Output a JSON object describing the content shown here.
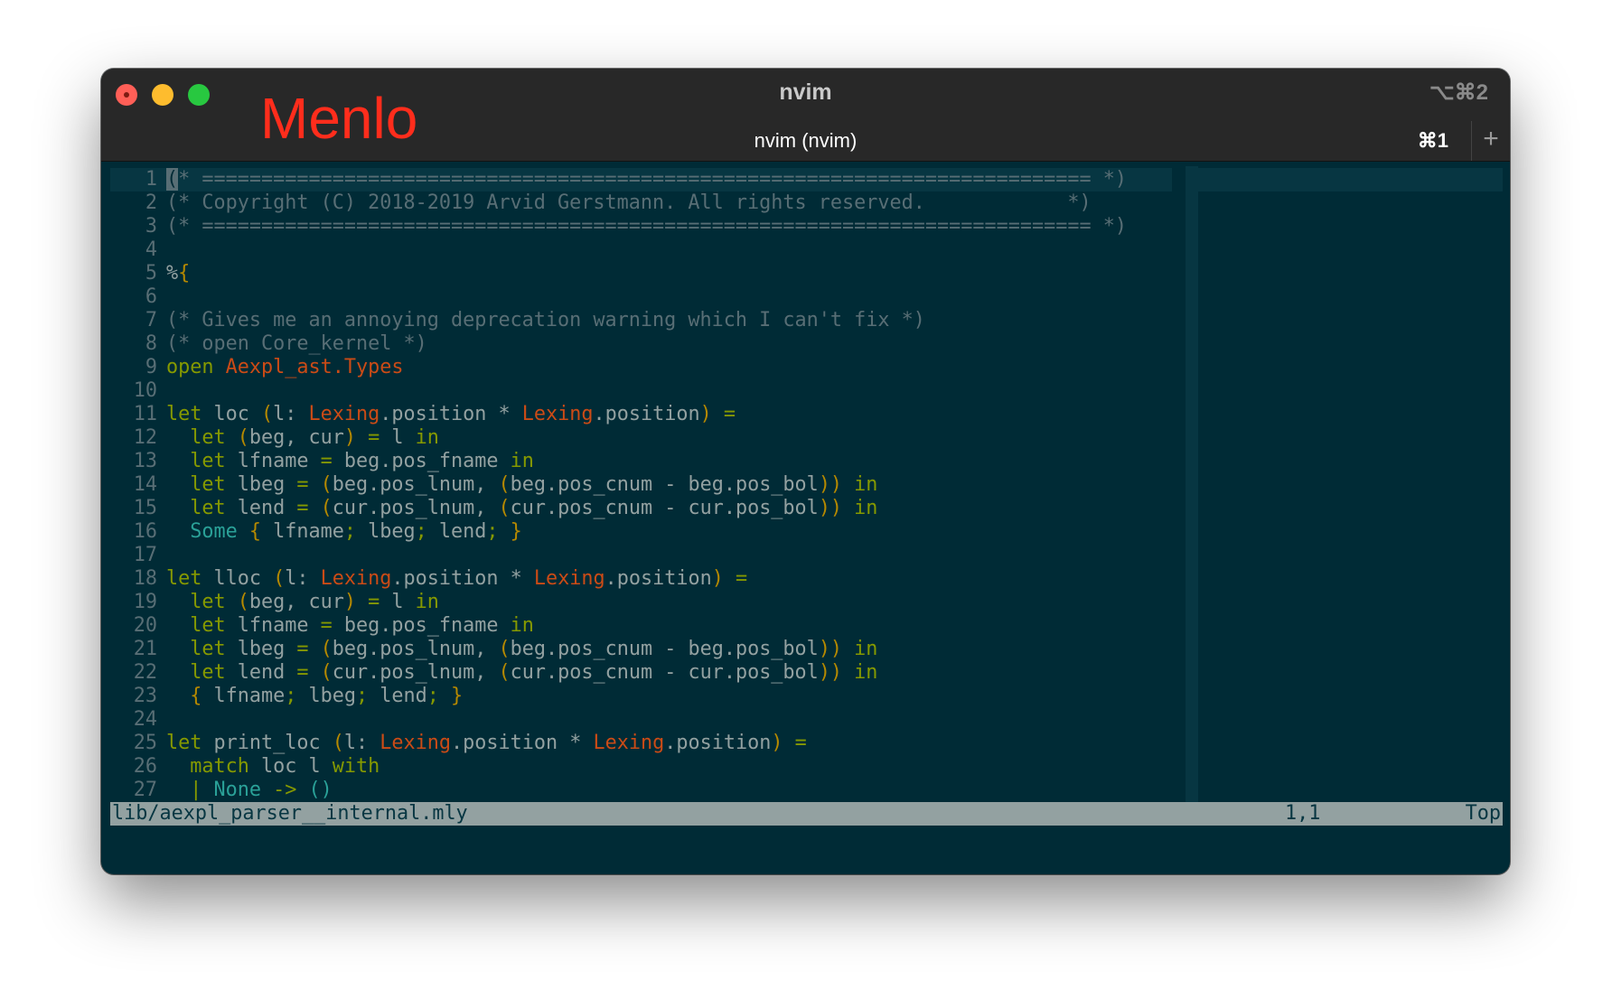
{
  "window": {
    "title": "nvim",
    "shortcut_right": "⌥⌘2",
    "font_label": "Menlo",
    "tab": {
      "title": "nvim (nvim)",
      "shortcut": "⌘1",
      "add_icon": "+"
    }
  },
  "colors": {
    "background": "#002b36",
    "comment": "#586e75",
    "keyword": "#859900",
    "module": "#cb4b16",
    "constructor": "#2aa198",
    "paren": "#b58900",
    "font_label": "#ff2d1c"
  },
  "editor": {
    "lines": [
      {
        "n": "1",
        "tokens": [
          {
            "t": "(",
            "c": "cursor"
          },
          {
            "t": "* =========================================================================== *)",
            "c": "comment"
          }
        ]
      },
      {
        "n": "2",
        "tokens": [
          {
            "t": "(* Copyright (C) 2018-2019 Arvid Gerstmann. All rights reserved.            *)",
            "c": "comment"
          }
        ]
      },
      {
        "n": "3",
        "tokens": [
          {
            "t": "(* =========================================================================== *)",
            "c": "comment"
          }
        ]
      },
      {
        "n": "4",
        "tokens": []
      },
      {
        "n": "5",
        "tokens": [
          {
            "t": "%",
            "c": "plain"
          },
          {
            "t": "{",
            "c": "paren"
          }
        ]
      },
      {
        "n": "6",
        "tokens": []
      },
      {
        "n": "7",
        "tokens": [
          {
            "t": "(* Gives me an annoying deprecation warning which I can't fix *)",
            "c": "comment"
          }
        ]
      },
      {
        "n": "8",
        "tokens": [
          {
            "t": "(* open Core_kernel *)",
            "c": "comment"
          }
        ]
      },
      {
        "n": "9",
        "tokens": [
          {
            "t": "open ",
            "c": "kw"
          },
          {
            "t": "Aexpl_ast.Types",
            "c": "mod"
          }
        ]
      },
      {
        "n": "10",
        "tokens": []
      },
      {
        "n": "11",
        "tokens": [
          {
            "t": "let",
            "c": "kw"
          },
          {
            "t": " loc ",
            "c": "plain"
          },
          {
            "t": "(",
            "c": "paren"
          },
          {
            "t": "l: ",
            "c": "plain"
          },
          {
            "t": "Lexing",
            "c": "mod"
          },
          {
            "t": ".position * ",
            "c": "plain"
          },
          {
            "t": "Lexing",
            "c": "mod"
          },
          {
            "t": ".position",
            "c": "plain"
          },
          {
            "t": ")",
            "c": "paren"
          },
          {
            "t": " =",
            "c": "kw"
          }
        ]
      },
      {
        "n": "12",
        "tokens": [
          {
            "t": "  let ",
            "c": "kw"
          },
          {
            "t": "(",
            "c": "paren"
          },
          {
            "t": "beg, cur",
            "c": "plain"
          },
          {
            "t": ")",
            "c": "paren"
          },
          {
            "t": " = ",
            "c": "kw"
          },
          {
            "t": "l ",
            "c": "plain"
          },
          {
            "t": "in",
            "c": "kw"
          }
        ]
      },
      {
        "n": "13",
        "tokens": [
          {
            "t": "  let ",
            "c": "kw"
          },
          {
            "t": "lfname ",
            "c": "plain"
          },
          {
            "t": "= ",
            "c": "kw"
          },
          {
            "t": "beg.pos_fname ",
            "c": "plain"
          },
          {
            "t": "in",
            "c": "kw"
          }
        ]
      },
      {
        "n": "14",
        "tokens": [
          {
            "t": "  let ",
            "c": "kw"
          },
          {
            "t": "lbeg ",
            "c": "plain"
          },
          {
            "t": "= ",
            "c": "kw"
          },
          {
            "t": "(",
            "c": "paren"
          },
          {
            "t": "beg.pos_lnum, ",
            "c": "plain"
          },
          {
            "t": "(",
            "c": "paren"
          },
          {
            "t": "beg.pos_cnum - beg.pos_bol",
            "c": "plain"
          },
          {
            "t": "))",
            "c": "paren"
          },
          {
            "t": " in",
            "c": "kw"
          }
        ]
      },
      {
        "n": "15",
        "tokens": [
          {
            "t": "  let ",
            "c": "kw"
          },
          {
            "t": "lend ",
            "c": "plain"
          },
          {
            "t": "= ",
            "c": "kw"
          },
          {
            "t": "(",
            "c": "paren"
          },
          {
            "t": "cur.pos_lnum, ",
            "c": "plain"
          },
          {
            "t": "(",
            "c": "paren"
          },
          {
            "t": "cur.pos_cnum - cur.pos_bol",
            "c": "plain"
          },
          {
            "t": "))",
            "c": "paren"
          },
          {
            "t": " in",
            "c": "kw"
          }
        ]
      },
      {
        "n": "16",
        "tokens": [
          {
            "t": "  Some ",
            "c": "con"
          },
          {
            "t": "{",
            "c": "paren"
          },
          {
            "t": " lfname",
            "c": "plain"
          },
          {
            "t": ";",
            "c": "kw"
          },
          {
            "t": " lbeg",
            "c": "plain"
          },
          {
            "t": ";",
            "c": "kw"
          },
          {
            "t": " lend",
            "c": "plain"
          },
          {
            "t": ";",
            "c": "kw"
          },
          {
            "t": " }",
            "c": "paren"
          }
        ]
      },
      {
        "n": "17",
        "tokens": []
      },
      {
        "n": "18",
        "tokens": [
          {
            "t": "let",
            "c": "kw"
          },
          {
            "t": " lloc ",
            "c": "plain"
          },
          {
            "t": "(",
            "c": "paren"
          },
          {
            "t": "l: ",
            "c": "plain"
          },
          {
            "t": "Lexing",
            "c": "mod"
          },
          {
            "t": ".position * ",
            "c": "plain"
          },
          {
            "t": "Lexing",
            "c": "mod"
          },
          {
            "t": ".position",
            "c": "plain"
          },
          {
            "t": ")",
            "c": "paren"
          },
          {
            "t": " =",
            "c": "kw"
          }
        ]
      },
      {
        "n": "19",
        "tokens": [
          {
            "t": "  let ",
            "c": "kw"
          },
          {
            "t": "(",
            "c": "paren"
          },
          {
            "t": "beg, cur",
            "c": "plain"
          },
          {
            "t": ")",
            "c": "paren"
          },
          {
            "t": " = ",
            "c": "kw"
          },
          {
            "t": "l ",
            "c": "plain"
          },
          {
            "t": "in",
            "c": "kw"
          }
        ]
      },
      {
        "n": "20",
        "tokens": [
          {
            "t": "  let ",
            "c": "kw"
          },
          {
            "t": "lfname ",
            "c": "plain"
          },
          {
            "t": "= ",
            "c": "kw"
          },
          {
            "t": "beg.pos_fname ",
            "c": "plain"
          },
          {
            "t": "in",
            "c": "kw"
          }
        ]
      },
      {
        "n": "21",
        "tokens": [
          {
            "t": "  let ",
            "c": "kw"
          },
          {
            "t": "lbeg ",
            "c": "plain"
          },
          {
            "t": "= ",
            "c": "kw"
          },
          {
            "t": "(",
            "c": "paren"
          },
          {
            "t": "beg.pos_lnum, ",
            "c": "plain"
          },
          {
            "t": "(",
            "c": "paren"
          },
          {
            "t": "beg.pos_cnum - beg.pos_bol",
            "c": "plain"
          },
          {
            "t": "))",
            "c": "paren"
          },
          {
            "t": " in",
            "c": "kw"
          }
        ]
      },
      {
        "n": "22",
        "tokens": [
          {
            "t": "  let ",
            "c": "kw"
          },
          {
            "t": "lend ",
            "c": "plain"
          },
          {
            "t": "= ",
            "c": "kw"
          },
          {
            "t": "(",
            "c": "paren"
          },
          {
            "t": "cur.pos_lnum, ",
            "c": "plain"
          },
          {
            "t": "(",
            "c": "paren"
          },
          {
            "t": "cur.pos_cnum - cur.pos_bol",
            "c": "plain"
          },
          {
            "t": "))",
            "c": "paren"
          },
          {
            "t": " in",
            "c": "kw"
          }
        ]
      },
      {
        "n": "23",
        "tokens": [
          {
            "t": "  { ",
            "c": "paren"
          },
          {
            "t": "lfname",
            "c": "plain"
          },
          {
            "t": ";",
            "c": "kw"
          },
          {
            "t": " lbeg",
            "c": "plain"
          },
          {
            "t": ";",
            "c": "kw"
          },
          {
            "t": " lend",
            "c": "plain"
          },
          {
            "t": ";",
            "c": "kw"
          },
          {
            "t": " }",
            "c": "paren"
          }
        ]
      },
      {
        "n": "24",
        "tokens": []
      },
      {
        "n": "25",
        "tokens": [
          {
            "t": "let",
            "c": "kw"
          },
          {
            "t": " print_loc ",
            "c": "plain"
          },
          {
            "t": "(",
            "c": "paren"
          },
          {
            "t": "l: ",
            "c": "plain"
          },
          {
            "t": "Lexing",
            "c": "mod"
          },
          {
            "t": ".position * ",
            "c": "plain"
          },
          {
            "t": "Lexing",
            "c": "mod"
          },
          {
            "t": ".position",
            "c": "plain"
          },
          {
            "t": ")",
            "c": "paren"
          },
          {
            "t": " =",
            "c": "kw"
          }
        ]
      },
      {
        "n": "26",
        "tokens": [
          {
            "t": "  match ",
            "c": "kw"
          },
          {
            "t": "loc l ",
            "c": "plain"
          },
          {
            "t": "with",
            "c": "kw"
          }
        ]
      },
      {
        "n": "27",
        "tokens": [
          {
            "t": "  | ",
            "c": "kw"
          },
          {
            "t": "None ",
            "c": "con"
          },
          {
            "t": "-> ",
            "c": "kw"
          },
          {
            "t": "()",
            "c": "con"
          }
        ]
      }
    ]
  },
  "statusline": {
    "file": "lib/aexpl_parser__internal.mly",
    "position": "1,1",
    "percent": "Top"
  }
}
